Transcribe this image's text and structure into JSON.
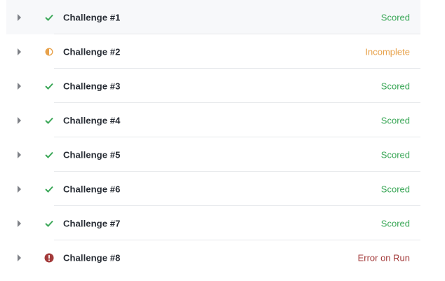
{
  "colors": {
    "scored": "#3aa757",
    "incomplete": "#e8a24b",
    "error": "#a33a3a"
  },
  "challenges": [
    {
      "label": "Challenge #1",
      "status": "Scored",
      "status_type": "scored",
      "icon": "check-icon"
    },
    {
      "label": "Challenge #2",
      "status": "Incomplete",
      "status_type": "incomplete",
      "icon": "half-circle-icon"
    },
    {
      "label": "Challenge #3",
      "status": "Scored",
      "status_type": "scored",
      "icon": "check-icon"
    },
    {
      "label": "Challenge #4",
      "status": "Scored",
      "status_type": "scored",
      "icon": "check-icon"
    },
    {
      "label": "Challenge #5",
      "status": "Scored",
      "status_type": "scored",
      "icon": "check-icon"
    },
    {
      "label": "Challenge #6",
      "status": "Scored",
      "status_type": "scored",
      "icon": "check-icon"
    },
    {
      "label": "Challenge #7",
      "status": "Scored",
      "status_type": "scored",
      "icon": "check-icon"
    },
    {
      "label": "Challenge #8",
      "status": "Error on Run",
      "status_type": "error",
      "icon": "error-icon"
    }
  ]
}
